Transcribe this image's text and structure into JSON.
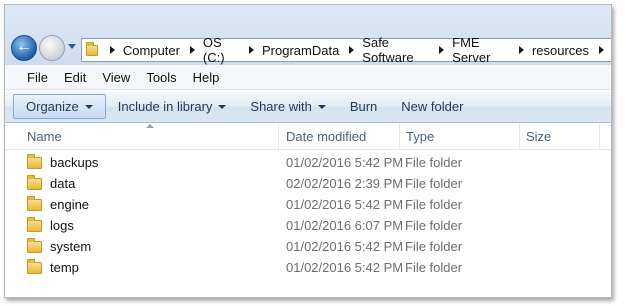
{
  "address": {
    "crumbs": [
      "Computer",
      "OS (C:)",
      "ProgramData",
      "Safe Software",
      "FME Server",
      "resources"
    ]
  },
  "menu": [
    "File",
    "Edit",
    "View",
    "Tools",
    "Help"
  ],
  "command_bar": {
    "organize": "Organize",
    "include": "Include in library",
    "share": "Share with",
    "burn": "Burn",
    "new_folder": "New folder"
  },
  "columns": {
    "name": "Name",
    "date": "Date modified",
    "type": "Type",
    "size": "Size"
  },
  "files": [
    {
      "name": "backups",
      "date": "01/02/2016 5:42 PM",
      "type": "File folder",
      "size": ""
    },
    {
      "name": "data",
      "date": "02/02/2016 2:39 PM",
      "type": "File folder",
      "size": ""
    },
    {
      "name": "engine",
      "date": "01/02/2016 5:42 PM",
      "type": "File folder",
      "size": ""
    },
    {
      "name": "logs",
      "date": "01/02/2016 6:07 PM",
      "type": "File folder",
      "size": ""
    },
    {
      "name": "system",
      "date": "01/02/2016 5:42 PM",
      "type": "File folder",
      "size": ""
    },
    {
      "name": "temp",
      "date": "01/02/2016 5:42 PM",
      "type": "File folder",
      "size": ""
    }
  ],
  "colors": {
    "accent": "#1e395b",
    "folder": "#e7b83c"
  }
}
